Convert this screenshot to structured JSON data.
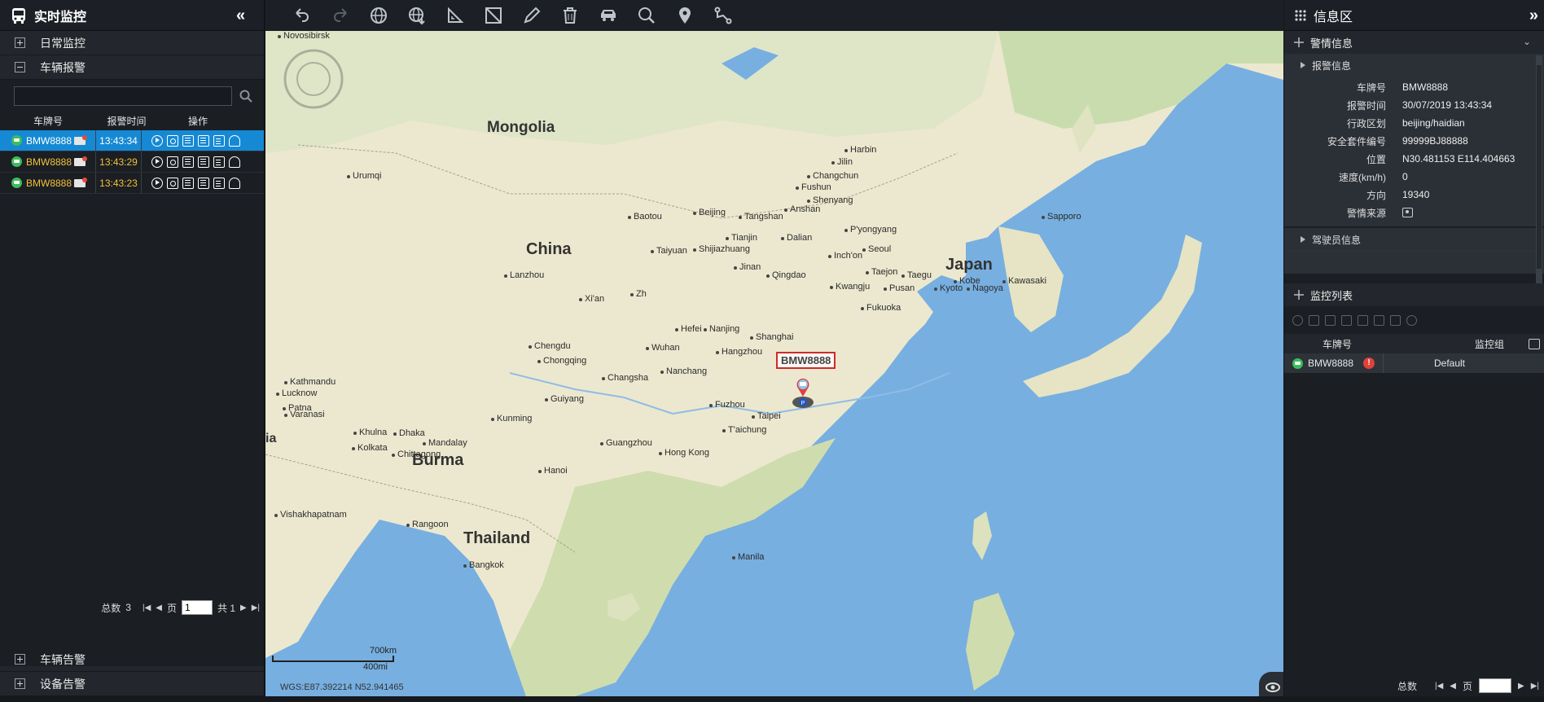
{
  "left_panel": {
    "title": "实时监控",
    "collapse_glyph": "«",
    "tree": {
      "daily": "日常监控",
      "alarm": "车辆报警",
      "vehicle_alert": "车辆告警",
      "device_alert": "设备告警"
    },
    "search": {
      "placeholder": "",
      "value": ""
    },
    "columns": {
      "plate": "车牌号",
      "time": "报警时间",
      "ops": "操作"
    },
    "rows": [
      {
        "plate": "BMW8888",
        "time": "13:43:34"
      },
      {
        "plate": "BMW8888",
        "time": "13:43:29"
      },
      {
        "plate": "BMW8888",
        "time": "13:43:23"
      }
    ],
    "pager": {
      "total_label": "总数",
      "total": "3",
      "page_label": "页",
      "page": "1",
      "of_label": "共 1"
    }
  },
  "map": {
    "countries": [
      "Mongolia",
      "China",
      "Japan",
      "Burma",
      "Thailand",
      "ia"
    ],
    "cities": [
      "Novosibirsk",
      "Urumqi",
      "Harbin",
      "Jilin",
      "Changchun",
      "Fushun",
      "Shenyang",
      "Anshan",
      "Sapporo",
      "Baotou",
      "Beijing",
      "Tangshan",
      "Tianjin",
      "Dalian",
      "P'yongyang",
      "Taiyuan",
      "Shijiazhuang",
      "Seoul",
      "Inch'on",
      "Jinan",
      "Qingdao",
      "Taejon",
      "Taegu",
      "Kwangju",
      "Pusan",
      "Kobe",
      "Kyoto",
      "Nagoya",
      "Kawasaki",
      "Fukuoka",
      "Lanzhou",
      "Xi'an",
      "Zh",
      "Hefei",
      "Nanjing",
      "Shanghai",
      "Wuhan",
      "Chengdu",
      "Chongqing",
      "Hangzhou",
      "Nanchang",
      "Changsha",
      "Kathmandu",
      "Lucknow",
      "Patna",
      "Varanasi",
      "Guiyang",
      "Fuzhou",
      "Taipei",
      "T'aichung",
      "Khulna",
      "Dhaka",
      "Kolkata",
      "Chittagong",
      "Kunming",
      "Mandalay",
      "Guangzhou",
      "Hong Kong",
      "Hanoi",
      "Vishakhapatnam",
      "Rangoon",
      "Manila",
      "Bangkok"
    ],
    "vehicle_label": "BMW8888",
    "scale_km": "700km",
    "scale_mi": "400mi",
    "coords": "WGS:E87.392214   N52.941465"
  },
  "toolbar": {
    "icons": [
      "undo-icon",
      "redo-icon",
      "globe-icon",
      "globe-download-icon",
      "measure-angle-icon",
      "measure-area-icon",
      "pencil-icon",
      "trash-icon",
      "vehicle-icon",
      "search-icon",
      "location-pin-icon",
      "route-icon"
    ]
  },
  "right_panel": {
    "title": "信息区",
    "expand_glyph": "»",
    "alarm_section": "警情信息",
    "alarm_sub": "报警信息",
    "alarm_info": [
      {
        "k": "车牌号",
        "v": "BMW8888"
      },
      {
        "k": "报警时间",
        "v": "30/07/2019 13:43:34"
      },
      {
        "k": "行政区划",
        "v": "beijing/haidian"
      },
      {
        "k": "安全套件编号",
        "v": "99999BJ88888"
      },
      {
        "k": "位置",
        "v": "N30.481153 E114.404663"
      },
      {
        "k": "速度(km/h)",
        "v": "0"
      },
      {
        "k": "方向",
        "v": "19340"
      },
      {
        "k": "警情来源",
        "v": ""
      }
    ],
    "driver_sub": "驾驶员信息",
    "monitor_section": "监控列表",
    "monitor_columns": {
      "plate": "车牌号",
      "group": "监控组"
    },
    "monitor_rows": [
      {
        "plate": "BMW8888",
        "group": "Default"
      }
    ],
    "pager": {
      "total_label": "总数",
      "page_label": "页"
    }
  },
  "colors": {
    "selected_row": "#1689d4",
    "plate_text": "#f3c23a",
    "alert": "#e0413a",
    "status_green": "#3bbd5a"
  }
}
